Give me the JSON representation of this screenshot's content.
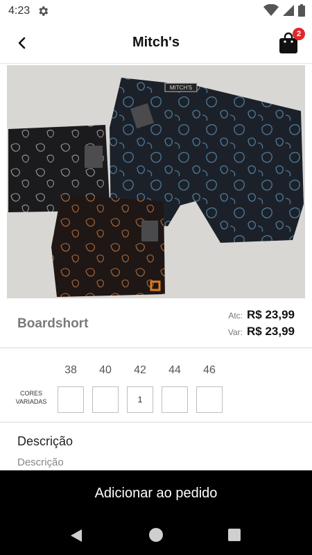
{
  "status_bar": {
    "time": "4:23",
    "icons": [
      "gear-icon",
      "wifi-icon",
      "signal-icon",
      "battery-icon"
    ]
  },
  "app_bar": {
    "title": "Mitch's",
    "back_icon": "chevron-left-icon",
    "cart_icon": "shopping-bag-icon",
    "cart_count": "2",
    "badge_color": "#e0272b"
  },
  "product_image": {
    "brand_text": "MITCH'S"
  },
  "product": {
    "name": "Boardshort",
    "prices": {
      "atc_label": "Atc:",
      "atc_value": "R$ 23,99",
      "var_label": "Var:",
      "var_value": "R$ 23,99"
    }
  },
  "sizes": {
    "color_label_line1": "CORES",
    "color_label_line2": "VARIADAS",
    "columns": [
      {
        "size": "38",
        "qty": ""
      },
      {
        "size": "40",
        "qty": ""
      },
      {
        "size": "42",
        "qty": "1"
      },
      {
        "size": "44",
        "qty": ""
      },
      {
        "size": "46",
        "qty": ""
      }
    ]
  },
  "description": {
    "title": "Descrição",
    "text": "Descrição"
  },
  "actions": {
    "add_to_order": "Adicionar ao pedido"
  },
  "nav_bar": {
    "icons": [
      "back-triangle-icon",
      "home-circle-icon",
      "recents-square-icon"
    ]
  }
}
